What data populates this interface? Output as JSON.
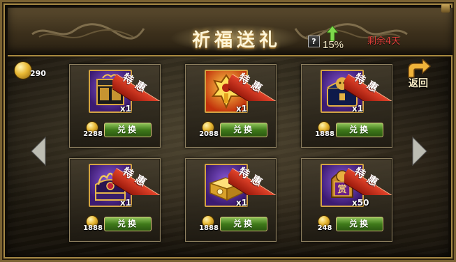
{
  "header": {
    "title": "祈福送礼",
    "help_label": "?",
    "progress_percent": "15%",
    "days_left": "剩余4天"
  },
  "balance": {
    "value": "290",
    "icon": "gold-coin-icon"
  },
  "back_button": {
    "label": "返回",
    "icon": "return-arrow-icon"
  },
  "navigation": {
    "prev_icon": "chevron-left-icon",
    "next_icon": "chevron-right-icon"
  },
  "offer_badge": "特惠",
  "exchange_label": "兑换",
  "colors": {
    "ribbon": "#c8301a",
    "button": "#4c8a22",
    "frame": "#a58845",
    "days_left": "#e0403a"
  },
  "items": [
    {
      "icon": "treasure-chest-icon",
      "theme": "purple",
      "quantity": "x1",
      "price": "2288"
    },
    {
      "icon": "golden-warrior-icon",
      "theme": "orange",
      "quantity": "x1",
      "price": "2088"
    },
    {
      "icon": "lion-chest-icon",
      "theme": "purple",
      "quantity": "x1",
      "price": "1888"
    },
    {
      "icon": "dragon-chest-icon",
      "theme": "purple",
      "quantity": "x1",
      "price": "1888"
    },
    {
      "icon": "gold-box-icon",
      "theme": "purple",
      "quantity": "x1",
      "price": "1888"
    },
    {
      "icon": "reward-token-icon",
      "theme": "purple",
      "quantity": "x50",
      "price": "248",
      "token_text": "赏"
    }
  ]
}
